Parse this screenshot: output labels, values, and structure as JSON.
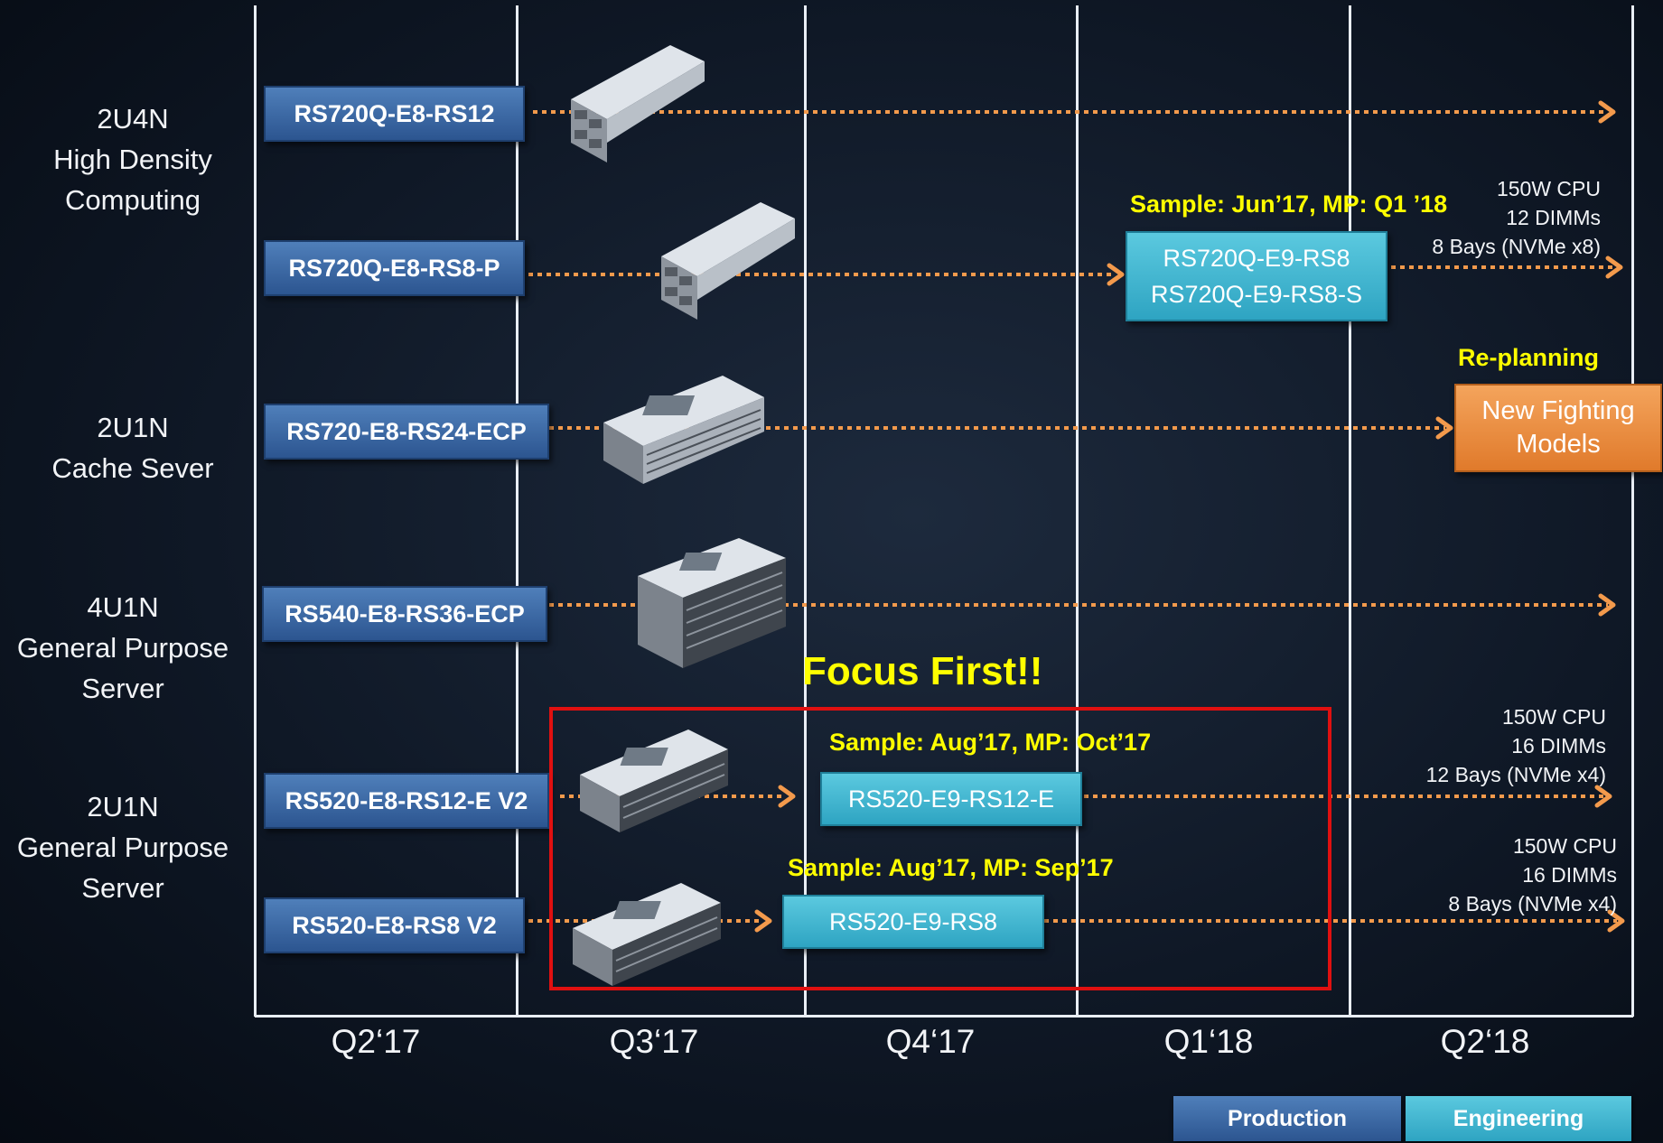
{
  "categories": [
    {
      "lines": [
        "2U4N",
        "High Density",
        "Computing"
      ]
    },
    {
      "lines": [
        "2U1N",
        "Cache Sever"
      ]
    },
    {
      "lines": [
        "4U1N",
        "General Purpose",
        "Server"
      ]
    },
    {
      "lines": [
        "2U1N",
        "General Purpose",
        "Server"
      ]
    }
  ],
  "production_models": [
    "RS720Q-E8-RS12",
    "RS720Q-E8-RS8-P",
    "RS720-E8-RS24-ECP",
    "RS540-E8-RS36-ECP",
    "RS520-E8-RS12-E V2",
    "RS520-E8-RS8 V2"
  ],
  "engineering_models": {
    "rs720q": [
      "RS720Q-E9-RS8",
      "RS720Q-E9-RS8-S"
    ],
    "rs520_12": "RS520-E9-RS12-E",
    "rs520_8": "RS520-E9-RS8"
  },
  "new_models": {
    "line1": "New Fighting",
    "line2": "Models"
  },
  "annotations": {
    "sample_rs720q": "Sample: Jun’17, MP: Q1 ’18",
    "replanning": "Re-planning",
    "focus": "Focus First!!",
    "sample_rs520_12": "Sample: Aug’17, MP: Oct’17",
    "sample_rs520_8": "Sample: Aug’17, MP: Sep’17"
  },
  "specs": {
    "rs720q": [
      "150W CPU",
      "12 DIMMs",
      "8 Bays (NVMe x8)"
    ],
    "rs520_12": [
      "150W CPU",
      "16 DIMMs",
      "12 Bays (NVMe x4)"
    ],
    "rs520_8": [
      "150W CPU",
      "16 DIMMs",
      "8 Bays (NVMe x4)"
    ]
  },
  "quarters": [
    "Q2‘17",
    "Q3‘17",
    "Q4‘17",
    "Q1‘18",
    "Q2‘18"
  ],
  "legend": {
    "production": "Production",
    "engineering": "Engineering"
  },
  "colors": {
    "production": "#3a68a8",
    "engineering": "#3cb7d2",
    "new_models": "#f0913f",
    "arrow": "#f39a4c",
    "highlight_text": "#ffff00",
    "focus_box": "#e01010"
  },
  "icons": {
    "server_image": "rack-server-icon",
    "timeline_arrow": "dotted-arrow-icon"
  }
}
